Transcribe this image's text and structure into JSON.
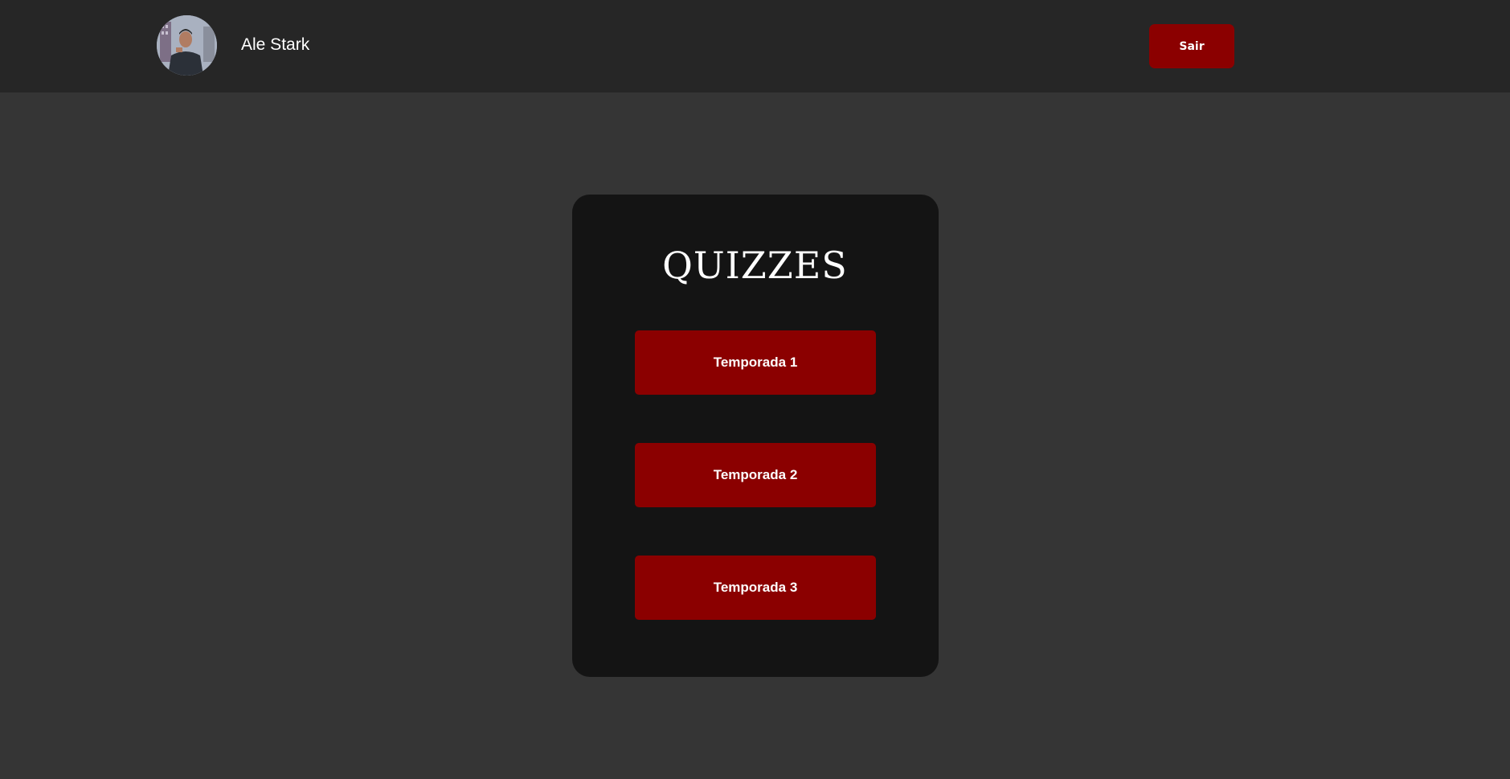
{
  "header": {
    "username": "Ale Stark",
    "logout_label": "Sair"
  },
  "main": {
    "title": "QUIZZES",
    "seasons": [
      {
        "label": "Temporada 1"
      },
      {
        "label": "Temporada 2"
      },
      {
        "label": "Temporada 3"
      }
    ]
  },
  "colors": {
    "accent": "#8b0000",
    "header_bg": "#262626",
    "page_bg": "#353535",
    "card_bg": "#141414"
  }
}
